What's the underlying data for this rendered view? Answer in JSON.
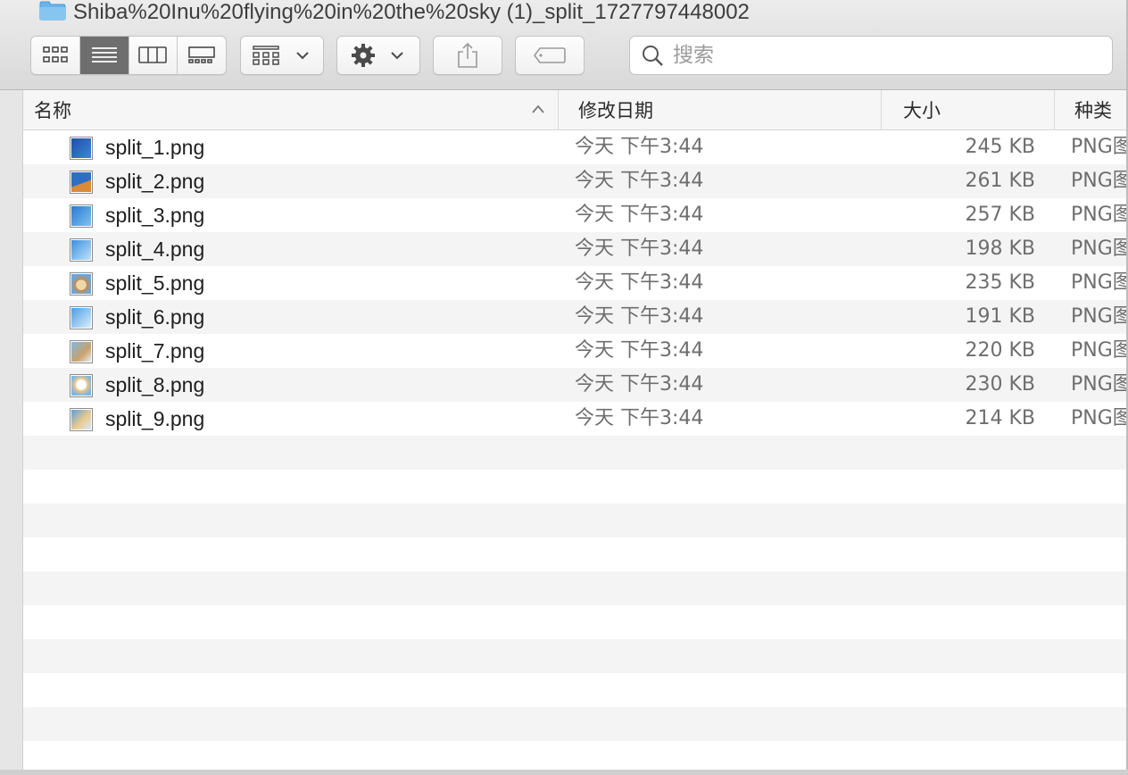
{
  "window": {
    "title": "Shiba%20Inu%20flying%20in%20the%20sky (1)_split_1727797448002"
  },
  "toolbar": {
    "view_buttons": [
      "icon-view",
      "list-view",
      "column-view",
      "gallery-view"
    ],
    "active_view": "list-view",
    "arrange_icon": "arrange-grid-icon",
    "action_icon": "gear-icon",
    "share_icon": "share-icon",
    "tags_icon": "tag-icon"
  },
  "search": {
    "placeholder": "搜索",
    "value": ""
  },
  "columns": {
    "name": "名称",
    "date": "修改日期",
    "size": "大小",
    "kind": "种类"
  },
  "files": [
    {
      "name": "split_1.png",
      "date": "今天 下午3:44",
      "size": "245 KB",
      "kind": "PNG图像"
    },
    {
      "name": "split_2.png",
      "date": "今天 下午3:44",
      "size": "261 KB",
      "kind": "PNG图像"
    },
    {
      "name": "split_3.png",
      "date": "今天 下午3:44",
      "size": "257 KB",
      "kind": "PNG图像"
    },
    {
      "name": "split_4.png",
      "date": "今天 下午3:44",
      "size": "198 KB",
      "kind": "PNG图像"
    },
    {
      "name": "split_5.png",
      "date": "今天 下午3:44",
      "size": "235 KB",
      "kind": "PNG图像"
    },
    {
      "name": "split_6.png",
      "date": "今天 下午3:44",
      "size": "191 KB",
      "kind": "PNG图像"
    },
    {
      "name": "split_7.png",
      "date": "今天 下午3:44",
      "size": "220 KB",
      "kind": "PNG图像"
    },
    {
      "name": "split_8.png",
      "date": "今天 下午3:44",
      "size": "230 KB",
      "kind": "PNG图像"
    },
    {
      "name": "split_9.png",
      "date": "今天 下午3:44",
      "size": "214 KB",
      "kind": "PNG图像"
    }
  ],
  "colors": {
    "alt_row": "#f4f4f5",
    "folder": "#6cb4e8",
    "active_segment": "#6e6e6e"
  }
}
